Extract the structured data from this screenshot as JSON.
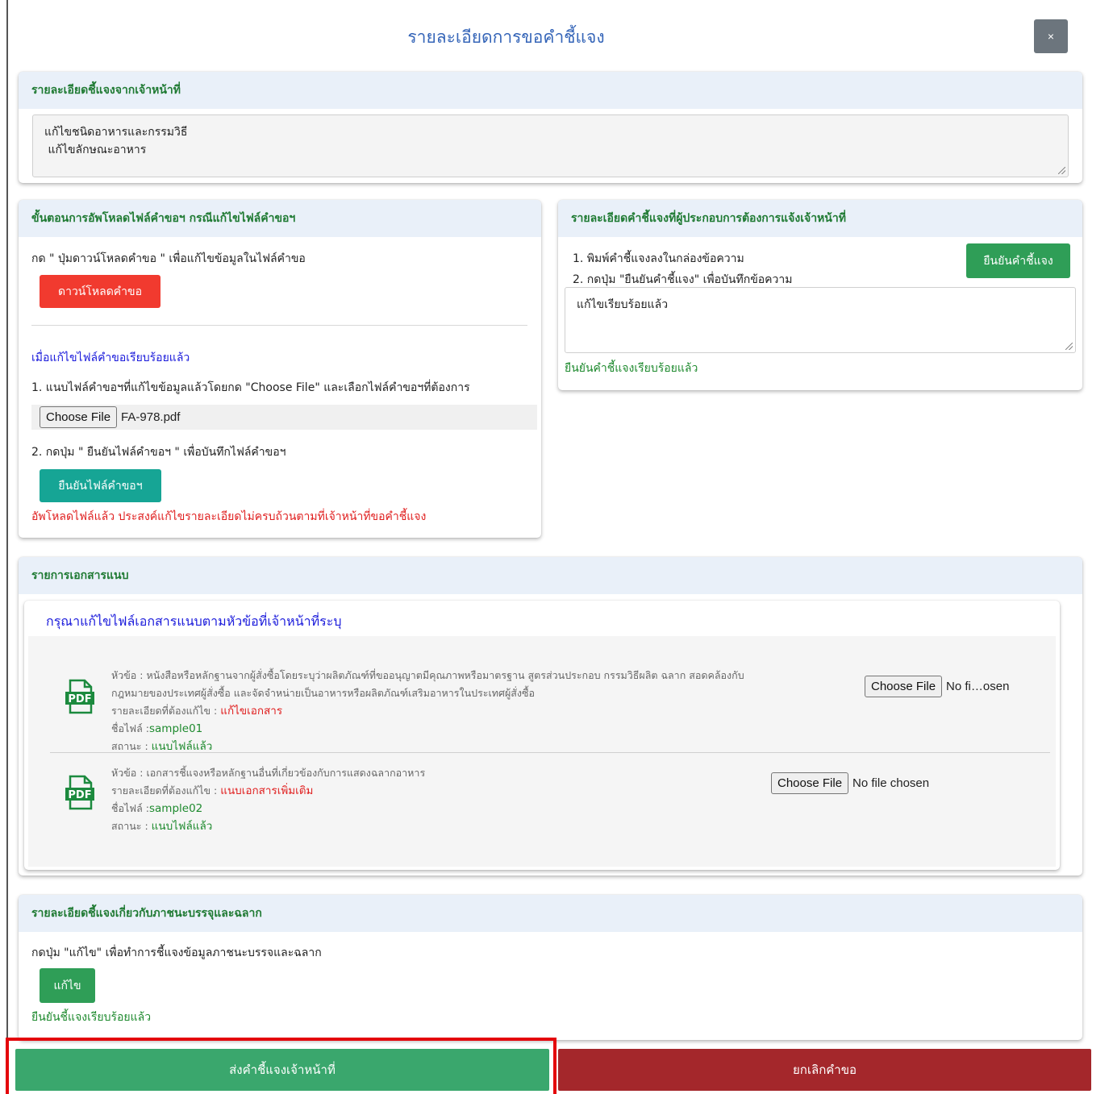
{
  "modal": {
    "title": "รายละเอียดการขอคำชี้แจง",
    "close_label": "×"
  },
  "officer_section": {
    "header": "รายละเอียดชี้แจงจากเจ้าหน้าที่",
    "lines": [
      "แก้ไขชนิดอาหารและกรรมวิธี",
      " แก้ไขลักษณะอาหาร"
    ]
  },
  "upload_section": {
    "header": "ขั้นตอนการอัพโหลดไฟล์คำขอฯ กรณีแก้ไขไฟล์คำขอฯ",
    "instruction": "กด \" ปุ่มดาวน์โหลดคำขอ \" เพื่อแก้ไขข้อมูลในไฟล์คำขอ",
    "download_button": "ดาวน์โหลดคำขอ",
    "subheading": "เมื่อแก้ไขไฟล์คำขอเรียบร้อยแล้ว",
    "step1": "1. แนบไฟล์คำขอฯที่แก้ไขข้อมูลแล้วโดยกด \"Choose File\" และเลือกไฟล์คำขอฯที่ต้องการ",
    "choose_file": "Choose File",
    "file_name": "FA-978.pdf",
    "step2": "2. กดปุ่ม \" ยืนยันไฟล์คำขอฯ \" เพื่อบันทึกไฟล์คำขอฯ",
    "confirm_button": "ยืนยันไฟล์คำขอฯ",
    "status": "อัพโหลดไฟล์แล้ว ประสงค์แก้ไขรายละเอียดไม่ครบถ้วนตามที่เจ้าหน้าที่ขอคำชี้แจง"
  },
  "operator_section": {
    "header": "รายละเอียดคำชี้แจงที่ผู้ประกอบการต้องการแจ้งเจ้าหน้าที่",
    "step1": "1. พิมพ์คำชี้แจงลงในกล่องข้อความ",
    "step2": "2. กดปุ่ม \"ยืนยันคำชี้แจง\" เพื่อบันทึกข้อความ",
    "confirm_button": "ยืนยันคำชี้แจง",
    "text_value": "แก้ไขเรียบร้อยแล้ว",
    "status": "ยืนยันคำชี้แจงเรียบร้อยแล้ว"
  },
  "attachments": {
    "header": "รายการเอกสารแนบ",
    "subtitle": "กรุณาแก้ไขไฟล์เอกสารแนบตามหัวข้อที่เจ้าหน้าที่ระบุ",
    "items": [
      {
        "topic_label": "หัวข้อ : ",
        "topic_line1": "หนังสือหรือหลักฐานจากผู้สั่งซื้อโดยระบุว่าผลิตภัณฑ์ที่ขออนุญาตมีคุณภาพหรือมาตรฐาน สูตรส่วนประกอบ กรรมวิธีผลิต ฉลาก สอดคล้องกับ",
        "topic_line2": "กฎหมายของประเทศผู้สั่งซื้อ และจัดจำหน่ายเป็นอาหารหรือผลิตภัณฑ์เสริมอาหารในประเทศผู้สั่งซื้อ",
        "detail_label": "รายละเอียดที่ต้องแก้ไข : ",
        "detail_value": "แก้ไขเอกสาร",
        "filename_label": "ชื่อไฟล์ :",
        "filename_value": "sample01",
        "status_label": "สถานะ : ",
        "status_value": "แนบไฟล์แล้ว",
        "choose_file": "Choose File",
        "file_state": "No fi…osen"
      },
      {
        "topic_label": "หัวข้อ : ",
        "topic_line1": "เอกสารชี้แจงหรือหลักฐานอื่นที่เกี่ยวข้องกับการแสดงฉลากอาหาร",
        "topic_line2": "",
        "detail_label": "รายละเอียดที่ต้องแก้ไข : ",
        "detail_value": "แนบเอกสารเพิ่มเติม",
        "filename_label": "ชื่อไฟล์ :",
        "filename_value": "sample02",
        "status_label": "สถานะ : ",
        "status_value": "แนบไฟล์แล้ว",
        "choose_file": "Choose File",
        "file_state": "No file chosen"
      }
    ],
    "pdf_icon_text": "PDF"
  },
  "packaging_section": {
    "header": "รายละเอียดชี้แจงเกี่ยวกับภาชนะบรรจุและฉลาก",
    "instruction": "กดปุ่ม \"แก้ไข\" เพื่อทำการชี้แจงข้อมูลภาชนะบรรจและฉลาก",
    "edit_button": "แก้ไข",
    "status": "ยืนยันชี้แจงเรียบร้อยแล้ว"
  },
  "footer": {
    "submit_button": "ส่งคำชี้แจงเจ้าหน้าที่",
    "cancel_button": "ยกเลิกคำขอ"
  },
  "colors": {
    "header_green": "#1f7a33",
    "title_blue": "#3565b8",
    "submit_green": "#3aa76d",
    "cancel_red": "#a4272b",
    "highlight_red": "#e4060b"
  }
}
